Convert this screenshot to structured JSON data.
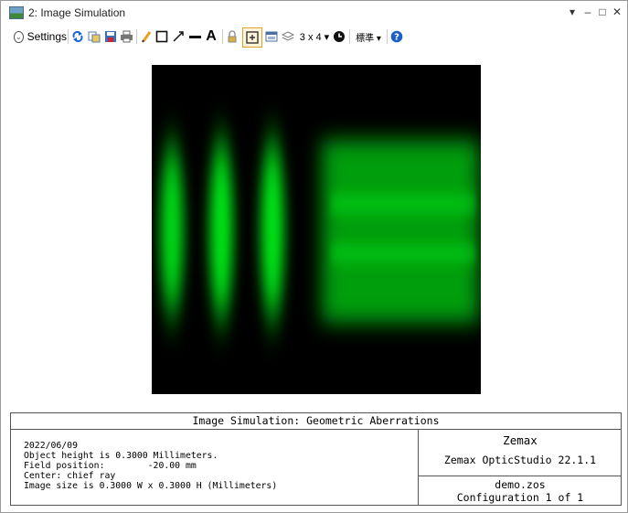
{
  "window": {
    "title": "2: Image Simulation",
    "controls": [
      "▾",
      "–",
      "□",
      "✕"
    ]
  },
  "toolbar": {
    "settings_label": "Settings",
    "grid_label": "3 x 4 ▾",
    "standard_label": "標準 ▾"
  },
  "info": {
    "title": "Image Simulation: Geometric Aberrations",
    "lines": [
      "2022/06/09",
      "Object height is 0.3000 Millimeters.",
      "Field position:        -20.00 mm",
      "Center: chief ray",
      "Image size is 0.3000 W x 0.3000 H (Millimeters)"
    ],
    "brand": "Zemax",
    "product": "Zemax OpticStudio 22.1.1",
    "file": "demo.zos",
    "configuration": "Configuration 1 of 1"
  },
  "colors": {
    "image_background": "#000000",
    "glow": "#00ff18",
    "help_blue": "#1a5fc8"
  }
}
